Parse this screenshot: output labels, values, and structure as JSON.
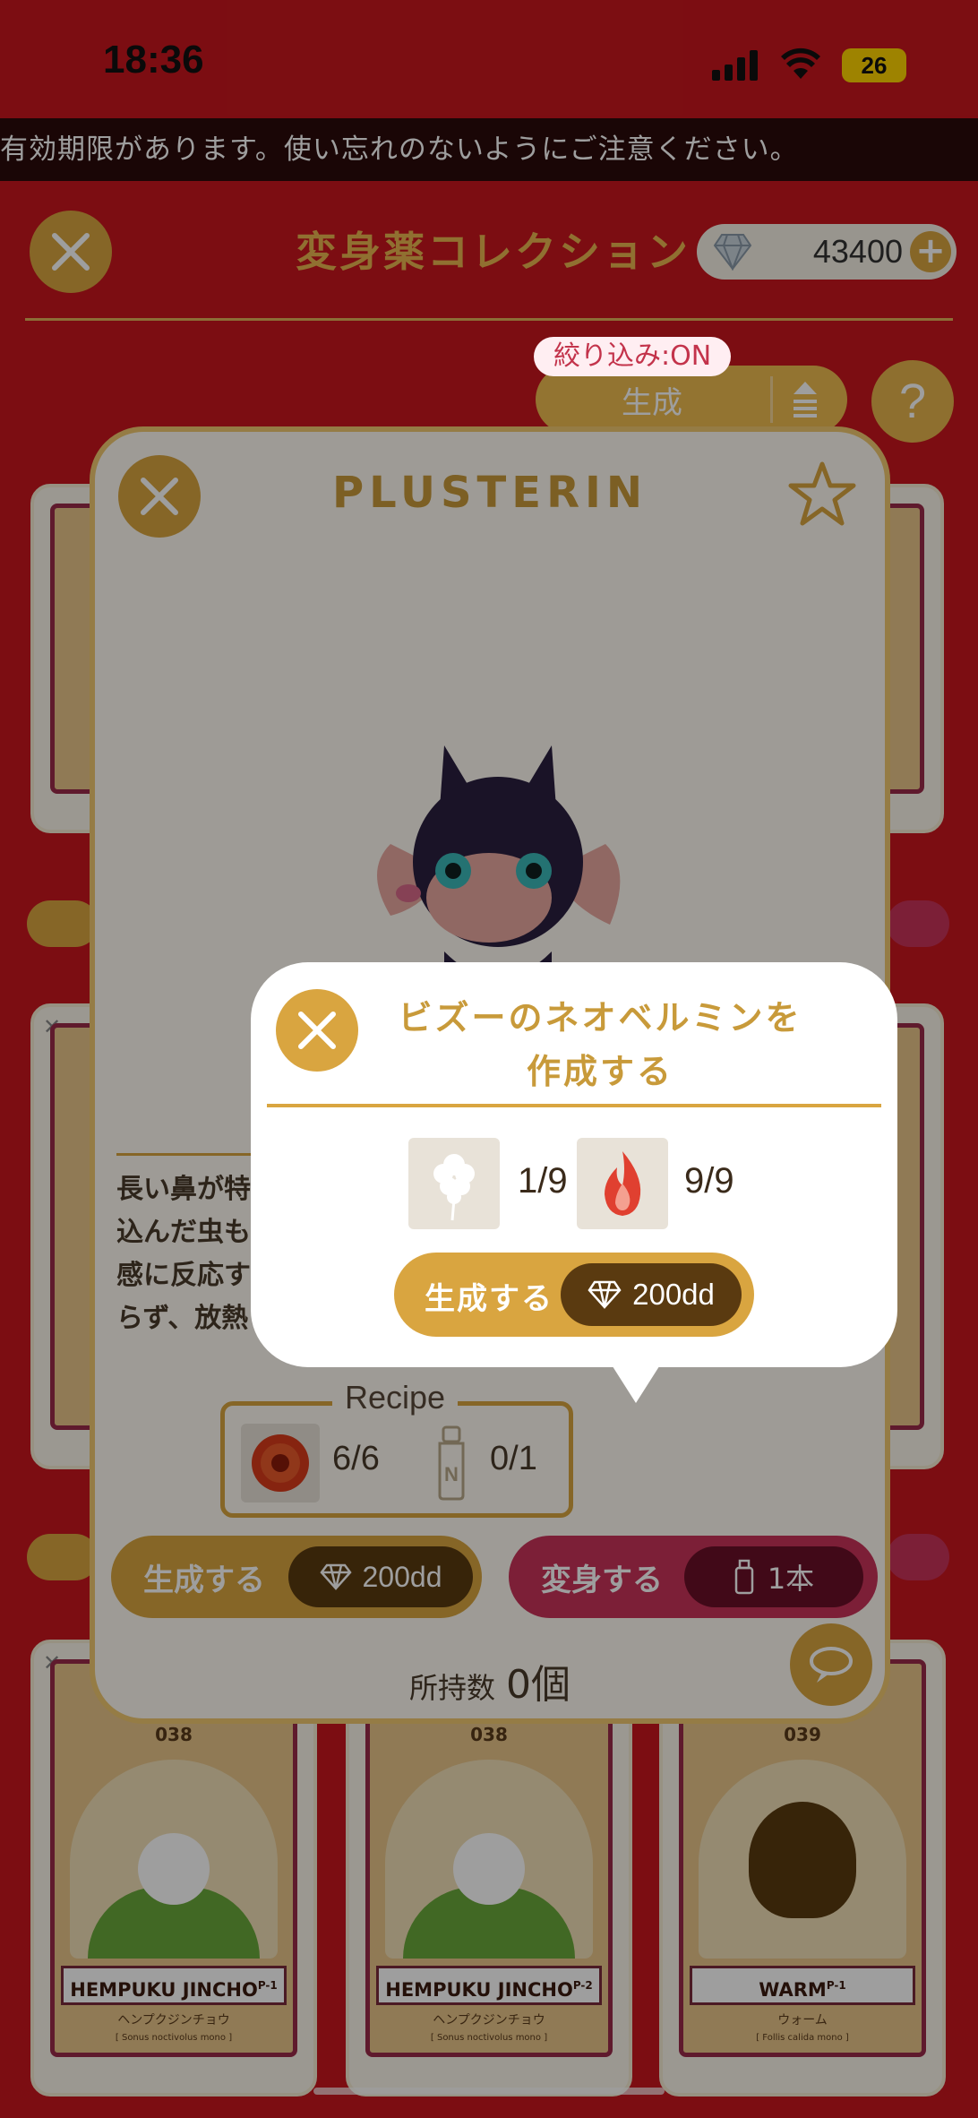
{
  "status_bar": {
    "time": "18:36",
    "battery": "26"
  },
  "ticker": "有効期限があります。使い忘れのないようにご注意ください。",
  "header": {
    "title": "変身薬コレクション",
    "gem_amount": "43400"
  },
  "filter": {
    "badge": "絞り込み:ON",
    "sort_label": "生成"
  },
  "detail": {
    "title": "PLUSTERIN",
    "description_lines": [
      "長い鼻が特",
      "込んだ虫も",
      "感に反応す",
      "らず、放熱"
    ],
    "recipe_label": "Recipe",
    "recipe": [
      {
        "icon": "red-flower-icon",
        "count": "6/6"
      },
      {
        "icon": "potion-bottle-icon",
        "count": "0/1"
      }
    ],
    "make_label": "生成する",
    "make_cost": "200dd",
    "transform_label": "変身する",
    "transform_cost": "1本",
    "owned_label": "所持数",
    "owned_value": "0個"
  },
  "popup": {
    "title_line1": "ビズーのネオベルミンを",
    "title_line2": "作成する",
    "ingredients": [
      {
        "icon": "white-flower-icon",
        "count": "1/9"
      },
      {
        "icon": "red-flame-icon",
        "count": "9/9"
      }
    ],
    "make_label": "生成する",
    "make_cost": "200dd"
  },
  "cards": [
    {
      "number": "038",
      "name": "HEMPUKU JINCHO",
      "suffix": "P-1",
      "kana": "ヘンプクジンチョウ",
      "latin": "[ Sonus noctivolus mono ]"
    },
    {
      "number": "038",
      "name": "HEMPUKU JINCHO",
      "suffix": "P-2",
      "kana": "ヘンプクジンチョウ",
      "latin": "[ Sonus noctivolus mono ]"
    },
    {
      "number": "039",
      "name": "WARM",
      "suffix": "P-1",
      "kana": "ウォーム",
      "latin": "[ Follis calida mono ]"
    }
  ],
  "colors": {
    "background": "#c8161d",
    "gold": "#d9a540",
    "pink": "#c8335a",
    "cream": "#fffbf2"
  }
}
